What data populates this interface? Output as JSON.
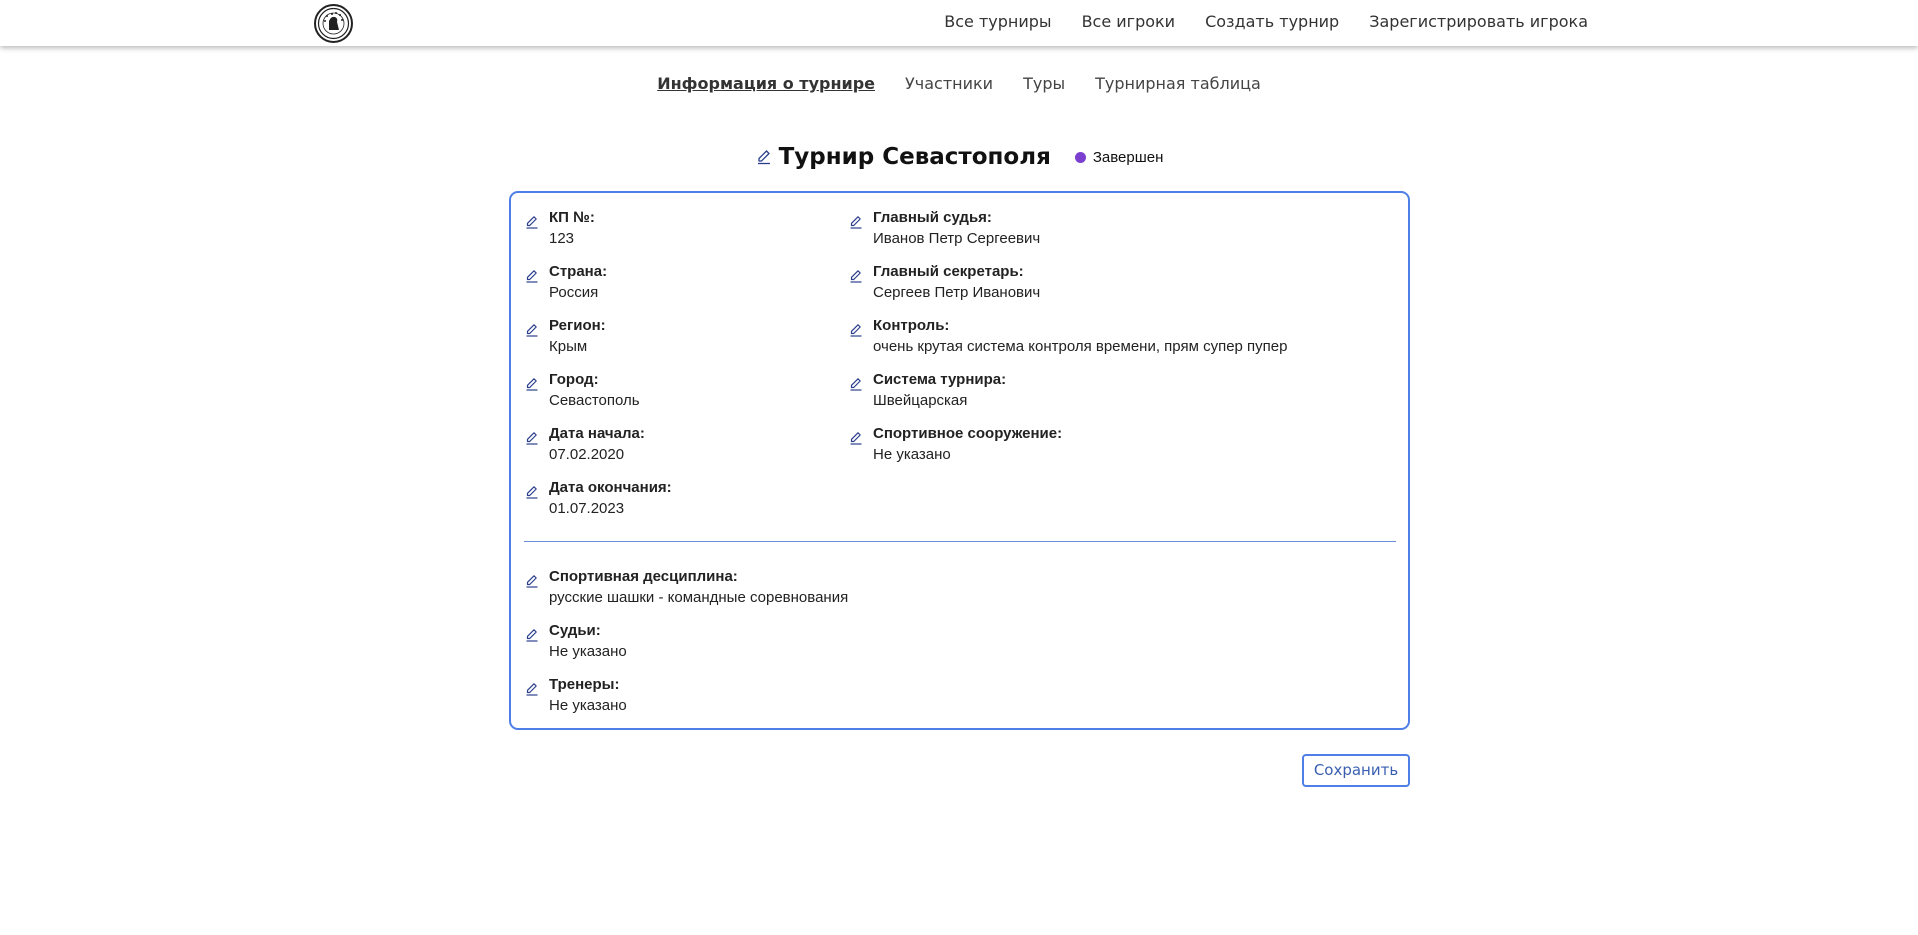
{
  "header": {
    "nav": [
      "Все турниры",
      "Все игроки",
      "Создать турнир",
      "Зарегистрировать игрока"
    ]
  },
  "subnav": {
    "tabs": [
      "Информация о турнире",
      "Участники",
      "Туры",
      "Турнирная таблица"
    ],
    "active_index": 0
  },
  "tournament": {
    "title": "Турнир Севастополя",
    "status": "Завершен",
    "status_color": "#7b3fd0"
  },
  "fields": {
    "left": [
      {
        "label": "КП №:",
        "value": "123"
      },
      {
        "label": "Страна:",
        "value": "Россия"
      },
      {
        "label": "Регион:",
        "value": "Крым"
      },
      {
        "label": "Город:",
        "value": "Севастополь"
      },
      {
        "label": "Дата начала:",
        "value": "07.02.2020"
      },
      {
        "label": "Дата окончания:",
        "value": "01.07.2023"
      }
    ],
    "right": [
      {
        "label": "Главный судья:",
        "value": "Иванов Петр Сергеевич"
      },
      {
        "label": "Главный секретарь:",
        "value": "Сергеев Петр Иванович"
      },
      {
        "label": "Контроль:",
        "value": "очень крутая система контроля времени, прям супер пупер"
      },
      {
        "label": "Система турнира:",
        "value": "Швейцарская"
      },
      {
        "label": "Спортивное сооружение:",
        "value": "Не указано"
      }
    ],
    "bottom": [
      {
        "label": "Спортивная десциплина:",
        "value": "русские шашки - командные соревнования"
      },
      {
        "label": "Судьи:",
        "value": "Не указано"
      },
      {
        "label": "Тренеры:",
        "value": "Не указано"
      }
    ]
  },
  "actions": {
    "save_label": "Сохранить"
  },
  "colors": {
    "accent": "#4f7fe6",
    "status": "#7b3fd0"
  }
}
